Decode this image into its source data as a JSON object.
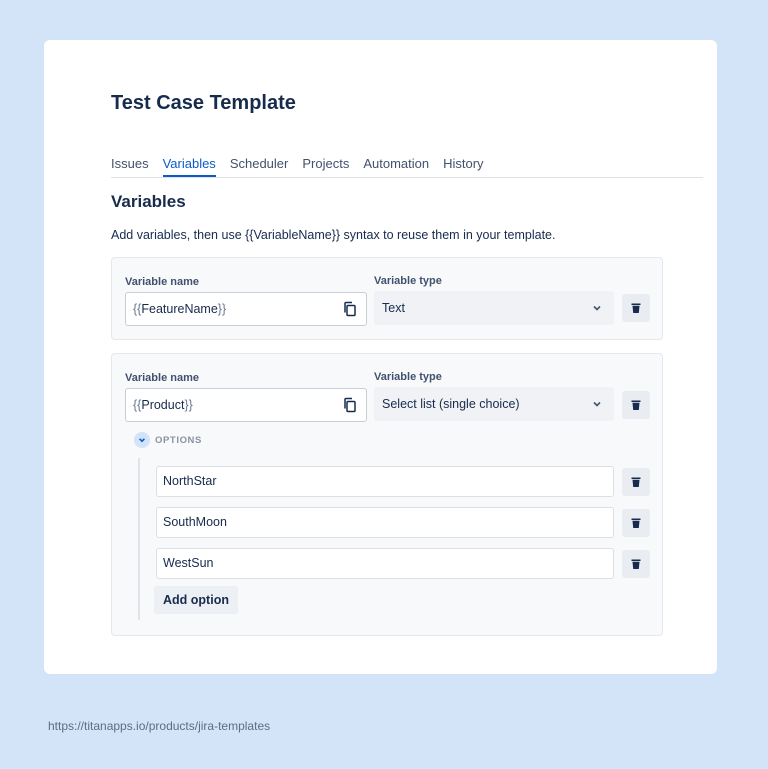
{
  "page": {
    "title": "Test Case Template"
  },
  "tabs": [
    {
      "label": "Issues",
      "active": false
    },
    {
      "label": "Variables",
      "active": true
    },
    {
      "label": "Scheduler",
      "active": false
    },
    {
      "label": "Projects",
      "active": false
    },
    {
      "label": "Automation",
      "active": false
    },
    {
      "label": "History",
      "active": false
    }
  ],
  "section": {
    "title": "Variables",
    "description": "Add variables, then use {{VariableName}} syntax to reuse them in your template."
  },
  "variables": [
    {
      "name_label": "Variable name",
      "name_open": "{{",
      "name_value": "FeatureName",
      "name_close": "}}",
      "type_label": "Variable type",
      "type_value": "Text"
    },
    {
      "name_label": "Variable name",
      "name_open": "{{",
      "name_value": "Product",
      "name_close": "}}",
      "type_label": "Variable type",
      "type_value": "Select list (single choice)",
      "options_label": "OPTIONS",
      "options": [
        "NorthStar",
        "SouthMoon",
        "WestSun"
      ],
      "add_option_label": "Add option"
    }
  ],
  "footer": {
    "url": "https://titanapps.io/products/jira-templates"
  },
  "icons": {
    "copy": "copy-icon",
    "trash": "trash-icon",
    "chevron": "chevron-down-icon"
  },
  "colors": {
    "background": "#d3e3f8",
    "accent": "#0c5cc7",
    "text": "#172b4d"
  }
}
